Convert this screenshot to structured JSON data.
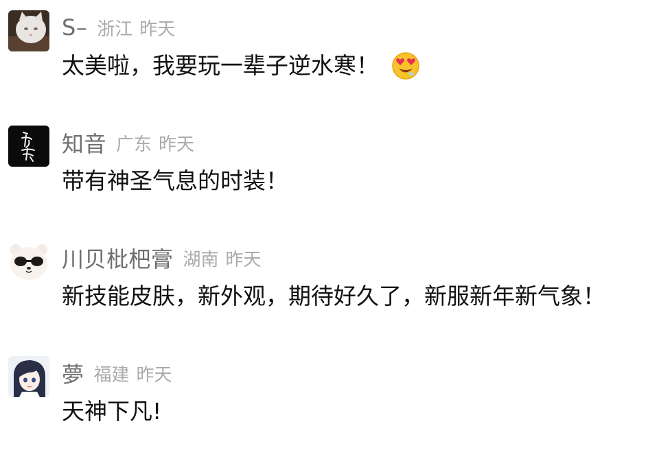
{
  "comments": [
    {
      "username": "S–",
      "region": "浙江",
      "time": "昨天",
      "text": "太美啦，我要玩一辈子逆水寒！",
      "emoji": "heart-eyes-emoji",
      "avatar": "white-cat-avatar"
    },
    {
      "username": "知音",
      "region": "广东",
      "time": "昨天",
      "text": "带有神圣气息的时装！",
      "avatar": "calligraphy-avatar"
    },
    {
      "username": "川贝枇杷膏",
      "region": "湖南",
      "time": "昨天",
      "text": "新技能皮肤，新外观，期待好久了，新服新年新气象！",
      "avatar": "sunglasses-bear-avatar"
    },
    {
      "username": "夢",
      "region": "福建",
      "time": "昨天",
      "text": "天神下凡!",
      "avatar": "anime-girl-avatar"
    }
  ],
  "colors": {
    "username": "#6f6f6f",
    "meta": "#ababab",
    "text": "#111111",
    "background": "#ffffff"
  }
}
